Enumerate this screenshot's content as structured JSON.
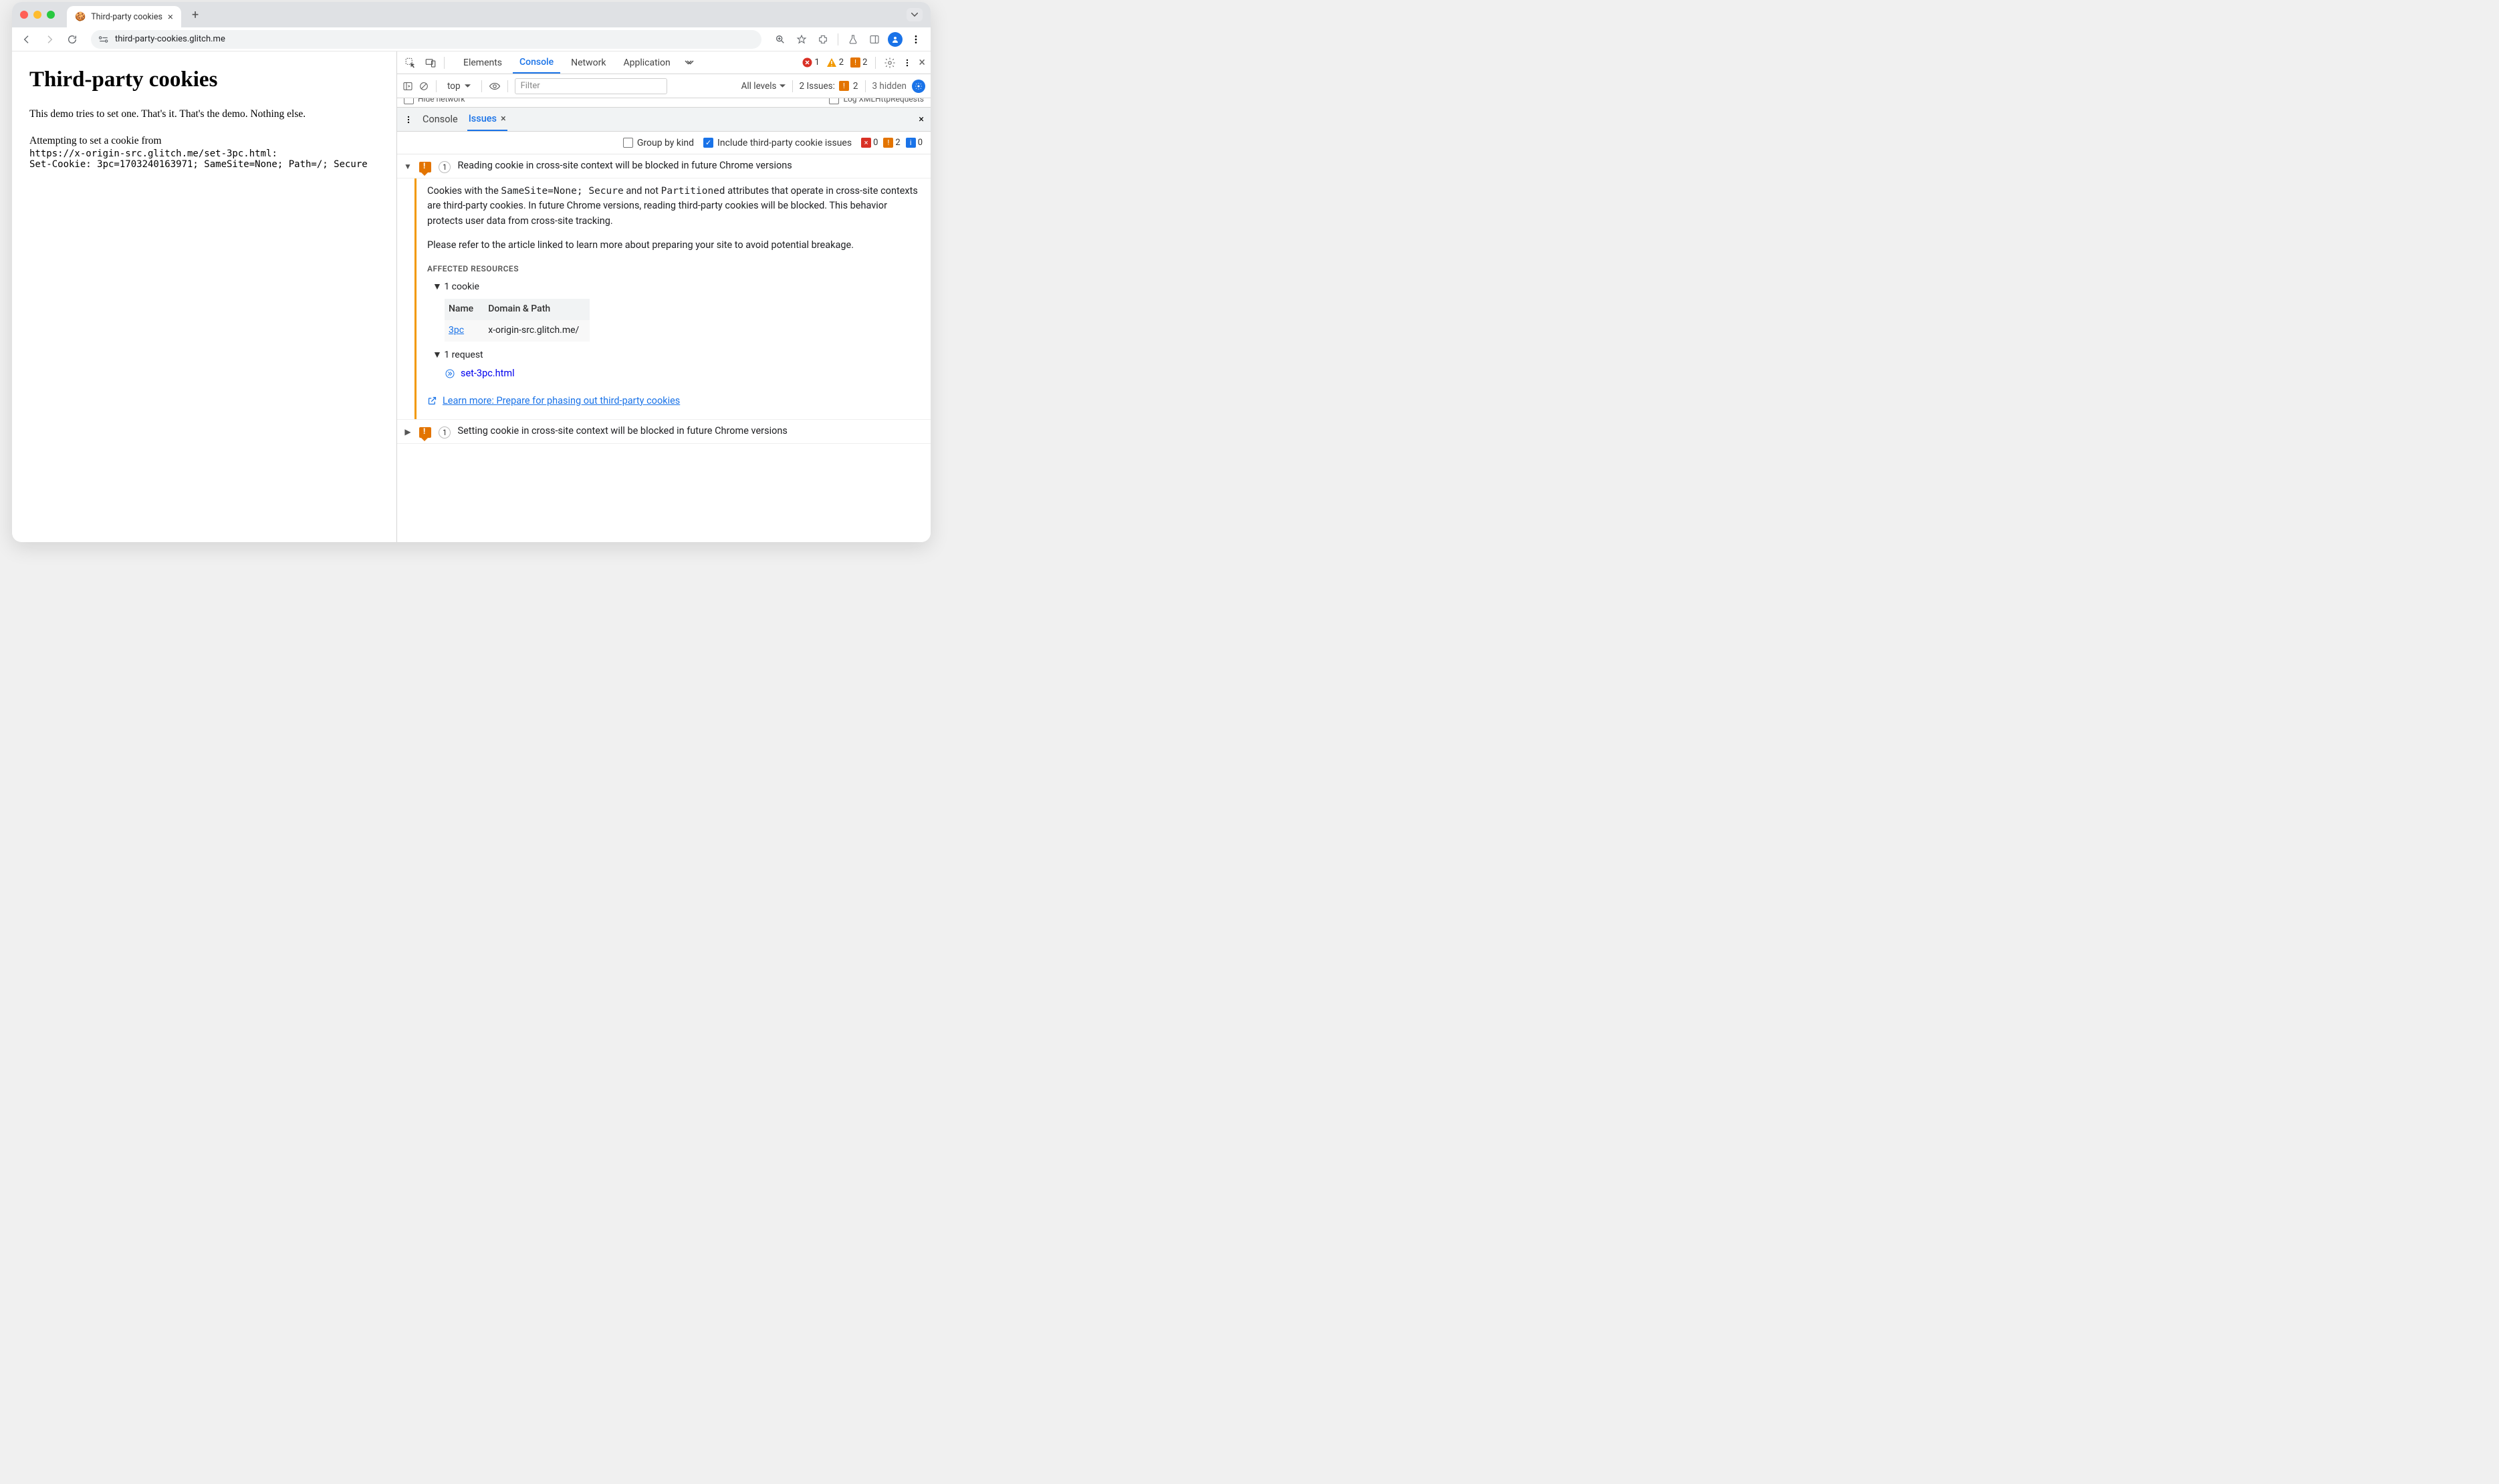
{
  "tab": {
    "title": "Third-party cookies",
    "favicon": "🍪"
  },
  "address": {
    "url": "third-party-cookies.glitch.me"
  },
  "page": {
    "title": "Third-party cookies",
    "desc": "This demo tries to set one. That's it. That's the demo. Nothing else.",
    "attempt": "Attempting to set a cookie from",
    "sourceUrl": "https://x-origin-src.glitch.me/set-3pc.html",
    "setCookie": "Set-Cookie: 3pc=1703240163971; SameSite=None; Path=/; Secure"
  },
  "devtools": {
    "tabs": [
      "Elements",
      "Console",
      "Network",
      "Application"
    ],
    "activeTab": "Console",
    "errors": "1",
    "warnings": "2",
    "issuesTop": "2",
    "sub": {
      "context": "top",
      "filterPlaceholder": "Filter",
      "levels": "All levels",
      "issuesLabel": "2 Issues:",
      "issuesCount": "2",
      "hidden": "3 hidden"
    },
    "cut": {
      "left": "Hide network",
      "right": "Log XMLHttpRequests"
    },
    "drawer": {
      "tabs": [
        "Console",
        "Issues"
      ],
      "active": "Issues"
    },
    "filters": {
      "group": "Group by kind",
      "thirdparty": "Include third-party cookie issues",
      "counts": {
        "err": "0",
        "warn": "2",
        "info": "0"
      }
    },
    "issues": [
      {
        "expanded": true,
        "count": "1",
        "title": "Reading cookie in cross-site context will be blocked in future Chrome versions",
        "body": {
          "p1a": "Cookies with the ",
          "code1": "SameSite=None; Secure",
          "p1b": " and not ",
          "code2": "Partitioned",
          "p1c": " attributes that operate in cross-site contexts are third-party cookies. In future Chrome versions, reading third-party cookies will be blocked. This behavior protects user data from cross-site tracking.",
          "p2": "Please refer to the article linked to learn more about preparing your site to avoid potential breakage.",
          "affectedTitle": "AFFECTED RESOURCES",
          "cookieToggle": "1 cookie",
          "cookieHeaders": {
            "name": "Name",
            "domain": "Domain & Path"
          },
          "cookieRow": {
            "name": "3pc",
            "domain": "x-origin-src.glitch.me/"
          },
          "requestToggle": "1 request",
          "requestLink": "set-3pc.html",
          "learnMore": "Learn more: Prepare for phasing out third-party cookies"
        }
      },
      {
        "expanded": false,
        "count": "1",
        "title": "Setting cookie in cross-site context will be blocked in future Chrome versions"
      }
    ]
  }
}
